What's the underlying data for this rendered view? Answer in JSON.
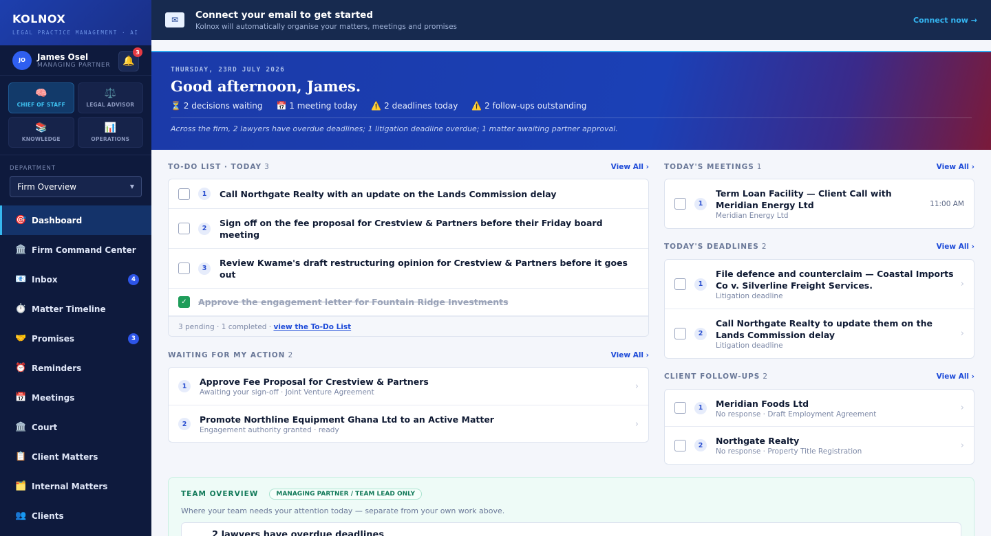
{
  "brand": {
    "name": "KOLNOX",
    "tagline": "LEGAL PRACTICE MANAGEMENT · AI"
  },
  "user": {
    "initials": "JO",
    "name": "James Osel",
    "role": "MANAGING PARTNER",
    "notifications": "3"
  },
  "modes": [
    {
      "icon": "🧠",
      "label": "CHIEF OF STAFF"
    },
    {
      "icon": "⚖️",
      "label": "LEGAL ADVISOR"
    },
    {
      "icon": "📚",
      "label": "KNOWLEDGE"
    },
    {
      "icon": "📊",
      "label": "OPERATIONS"
    }
  ],
  "department": {
    "label": "DEPARTMENT",
    "selected": "Firm Overview"
  },
  "nav": [
    {
      "icon": "🎯",
      "label": "Dashboard"
    },
    {
      "icon": "🏛️",
      "label": "Firm Command Center"
    },
    {
      "icon": "📧",
      "label": "Inbox",
      "badge": "4"
    },
    {
      "icon": "⏱️",
      "label": "Matter Timeline"
    },
    {
      "icon": "🤝",
      "label": "Promises",
      "badge": "3"
    },
    {
      "icon": "⏰",
      "label": "Reminders"
    },
    {
      "icon": "📅",
      "label": "Meetings"
    },
    {
      "icon": "🏛️",
      "label": "Court"
    },
    {
      "icon": "📋",
      "label": "Client Matters"
    },
    {
      "icon": "🗂️",
      "label": "Internal Matters"
    },
    {
      "icon": "👥",
      "label": "Clients"
    }
  ],
  "email_banner": {
    "title": "Connect your email to get started",
    "subtitle": "Kolnox will automatically organise your matters, meetings and promises",
    "action": "Connect now →"
  },
  "hero": {
    "date": "THURSDAY, 23RD JULY 2026",
    "greeting": "Good afternoon, James.",
    "stats": [
      "⏳ 2 decisions waiting",
      "📅 1 meeting today",
      "⚠️ 2 deadlines today",
      "⚠️ 2 follow-ups outstanding"
    ],
    "note": "Across the firm, 2 lawyers have overdue deadlines; 1 litigation deadline overdue; 1 matter awaiting partner approval."
  },
  "todo": {
    "title": "TO-DO LIST · TODAY",
    "count": "3",
    "view_all": "View All ›",
    "items": [
      {
        "num": "1",
        "title": "Call Northgate Realty with an update on the Lands Commission delay"
      },
      {
        "num": "2",
        "title": "Sign off on the fee proposal for Crestview & Partners before their Friday board meeting"
      },
      {
        "num": "3",
        "title": "Review Kwame's draft restructuring opinion for Crestview & Partners before it goes out"
      },
      {
        "num": "✓",
        "title": "Approve the engagement letter for Fountain Ridge Investments"
      }
    ],
    "footer_text": "3 pending · 1 completed · ",
    "footer_link": "view the To-Do List"
  },
  "waiting": {
    "title": "WAITING FOR MY ACTION",
    "count": "2",
    "view_all": "View All ›",
    "items": [
      {
        "num": "1",
        "title": "Approve Fee Proposal for Crestview & Partners",
        "sub": "Awaiting your sign-off · Joint Venture Agreement"
      },
      {
        "num": "2",
        "title": "Promote Northline Equipment Ghana Ltd to an Active Matter",
        "sub": "Engagement authority granted · ready"
      }
    ]
  },
  "meetings": {
    "title": "TODAY'S MEETINGS",
    "count": "1",
    "view_all": "View All ›",
    "items": [
      {
        "num": "1",
        "title": "Term Loan Facility — Client Call with Meridian Energy Ltd",
        "sub": "Meridian Energy Ltd",
        "time": "11:00 AM"
      }
    ]
  },
  "deadlines": {
    "title": "TODAY'S DEADLINES",
    "count": "2",
    "view_all": "View All ›",
    "items": [
      {
        "num": "1",
        "title": "File defence and counterclaim — Coastal Imports Co v. Silverline Freight Services.",
        "sub": "Litigation deadline"
      },
      {
        "num": "2",
        "title": "Call Northgate Realty to update them on the Lands Commission delay",
        "sub": "Litigation deadline"
      }
    ]
  },
  "followups": {
    "title": "CLIENT FOLLOW-UPS",
    "count": "2",
    "view_all": "View All ›",
    "items": [
      {
        "num": "1",
        "title": "Meridian Foods Ltd",
        "sub": "No response · Draft Employment Agreement"
      },
      {
        "num": "2",
        "title": "Northgate Realty",
        "sub": "No response · Property Title Registration"
      }
    ]
  },
  "team": {
    "title": "TEAM OVERVIEW",
    "pill": "MANAGING PARTNER / TEAM LEAD ONLY",
    "subtitle": "Where your team needs your attention today — separate from your own work above.",
    "first_item": "2 lawyers have overdue deadlines"
  },
  "colors": {
    "accent": "#1e4bd8",
    "sidebar": "#0e1a3d",
    "success": "#1f9d5a",
    "alert": "#e53a43"
  }
}
